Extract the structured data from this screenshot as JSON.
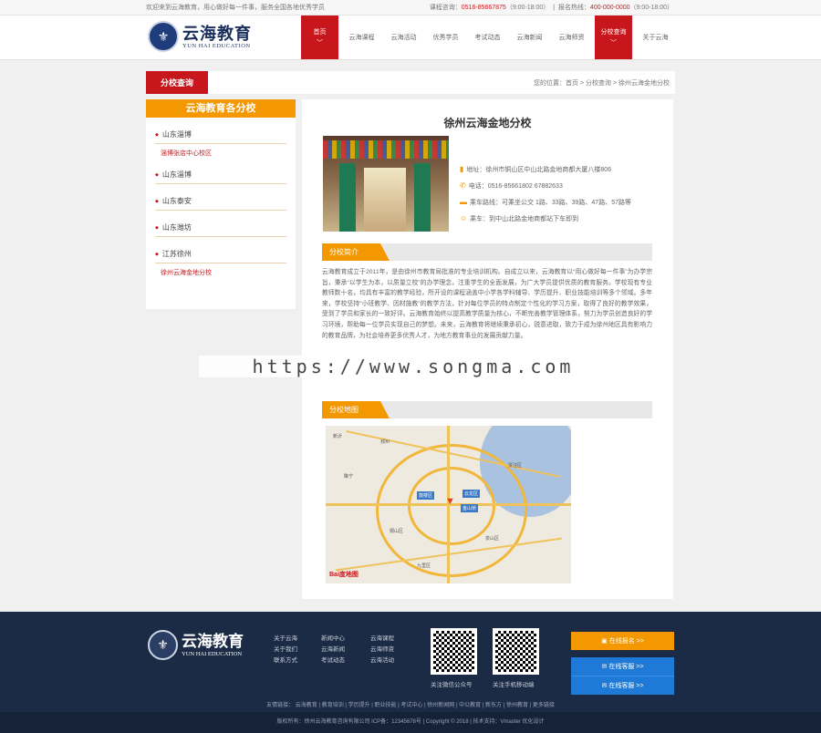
{
  "topbar": {
    "left_text": "欢迎来到云海教育，用心做好每一件事，服务全国各地优秀学员",
    "right_label_1": "课程咨询：",
    "phone_1": "0516-85667875",
    "hours_1": "（9:00-18:00）",
    "right_label_2": "报名热线：",
    "phone_2": "400-000-0000",
    "hours_2": "（9:00-18:00）"
  },
  "logo": {
    "cn": "云海教育",
    "en": "YUN HAI EDUCATION"
  },
  "nav": {
    "items": [
      {
        "label": "首页"
      },
      {
        "label": "云海课程"
      },
      {
        "label": "云海活动"
      },
      {
        "label": "优秀学员"
      },
      {
        "label": "考试动态"
      },
      {
        "label": "云海新闻"
      },
      {
        "label": "云海师资"
      },
      {
        "label": "分校查询"
      },
      {
        "label": "关于云海"
      }
    ]
  },
  "crumbbar": {
    "tab_label": "分校查询",
    "breadcrumb": "您的位置：首页 > 分校查询 > 徐州云海金地分校"
  },
  "sidebar": {
    "heading": "云海教育各分校",
    "groups": [
      {
        "title": "山东淄博",
        "sub": "淄博张店中心校区"
      },
      {
        "title": "山东淄博"
      },
      {
        "title": "山东泰安"
      },
      {
        "title": "山东潍坊"
      },
      {
        "title": "江苏徐州",
        "sub": "徐州云海金地分校"
      }
    ]
  },
  "main": {
    "title": "徐州云海金地分校",
    "info": [
      {
        "icon": "location-icon",
        "text": "地址：徐州市铜山区中山北路金地商都大厦八楼806"
      },
      {
        "icon": "phone-icon",
        "text": "电话：0516-85661802 67882633"
      },
      {
        "icon": "bus-icon",
        "text": "乘车路线：可乘坐公交 1路、33路、39路、47路、57路等"
      },
      {
        "icon": "people-icon",
        "text": "乘车：到中山北路金地商都站下车即到"
      }
    ],
    "intro_heading": "分校简介",
    "intro_text": "云海教育成立于2011年，是由徐州市教育局批准的专业培训机构。自成立以来，云海教育以“用心做好每一件事”为办学宗旨，秉承“以学生为本，以质量立校”的办学理念，注重学生的全面发展，为广大学员提供优质的教育服务。学校现有专业教师数十名，均具有丰富的教学经验，所开设的课程涵盖中小学各学科辅导、学历提升、职业技能培训等多个领域。多年来，学校坚持“小班教学、因材施教”的教学方法，针对每位学员的特点制定个性化的学习方案，取得了良好的教学效果，受到了学员和家长的一致好评。云海教育始终以提高教学质量为核心，不断完善教学管理体系，努力为学员创造良好的学习环境，帮助每一位学员实现自己的梦想。未来，云海教育将继续秉承初心，锐意进取，致力于成为徐州地区具有影响力的教育品牌，为社会培养更多优秀人才，为地方教育事业的发展贡献力量。",
    "map_heading": "分校地图",
    "map_places": [
      "新沂",
      "邳州",
      "睢宁",
      "铜山区",
      "贾汪区",
      "九里区",
      "泉山区",
      "云龙区",
      "鼓楼区",
      "金山桥"
    ],
    "map_logo": "Bai度地图"
  },
  "watermark": "https://www.songma.com",
  "footer": {
    "logo_cn": "云海教育",
    "logo_en": "YUN HAI EDUCATION",
    "col1": [
      "关于云海",
      "关于我们",
      "联系方式"
    ],
    "col2": [
      "新闻中心",
      "云海新闻",
      "考试动态"
    ],
    "col3": [
      "云海课程",
      "云海师资",
      "云海活动"
    ],
    "qr1_caption": "关注微信公众号",
    "qr2_caption": "关注手机移动端",
    "btn_signup": "在线报名 >>",
    "btn_consult": "在线客服 >>",
    "btn_service": "在线客服 >>",
    "friend_links": "友情链接：  云海教育  |  教育培训  |  学历提升  |  职业技能  |  考试中心  |  徐州新闻网  |  中公教育  |  新东方  |  徐州教育  |  更多链接",
    "copyright": "版权所有：徐州云海教育咨询有限公司  ICP备：12345678号  |  Copyright © 2018  |  技术支持：Vmaster 优化设计"
  }
}
